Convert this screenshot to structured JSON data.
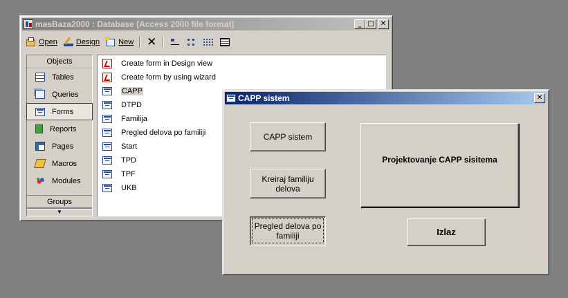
{
  "db_window": {
    "title": "masBaza2000 : Database (Access 2000 file format)",
    "controls": {
      "minimize": "_",
      "maximize": "□",
      "close": "✕"
    },
    "toolbar": {
      "open": "Open",
      "design": "Design",
      "new": "New"
    },
    "objects_header": "Objects",
    "groups_header": "Groups",
    "scroll_down": "▼",
    "objects": [
      {
        "label": "Tables",
        "icon": "table-icon"
      },
      {
        "label": "Queries",
        "icon": "query-icon"
      },
      {
        "label": "Forms",
        "icon": "form-icon",
        "selected": true
      },
      {
        "label": "Reports",
        "icon": "report-icon"
      },
      {
        "label": "Pages",
        "icon": "page-icon"
      },
      {
        "label": "Macros",
        "icon": "macro-icon"
      },
      {
        "label": "Modules",
        "icon": "module-icon"
      }
    ],
    "list": [
      {
        "label": "Create form in Design view",
        "icon": "wizard-icon"
      },
      {
        "label": "Create form by using wizard",
        "icon": "wizard-icon"
      },
      {
        "label": "CAPP",
        "icon": "form-icon",
        "selected": true
      },
      {
        "label": "DTPD",
        "icon": "form-icon"
      },
      {
        "label": "Familija",
        "icon": "form-icon"
      },
      {
        "label": "Pregled delova po familiji",
        "icon": "form-icon"
      },
      {
        "label": "Start",
        "icon": "form-icon"
      },
      {
        "label": "TPD",
        "icon": "form-icon"
      },
      {
        "label": "TPF",
        "icon": "form-icon"
      },
      {
        "label": "UKB",
        "icon": "form-icon"
      }
    ]
  },
  "capp_window": {
    "title": "CAPP sistem",
    "close": "✕",
    "buttons": {
      "capp_sistem": "CAPP sistem",
      "kreiraj_line1": "Kreiraj familiju",
      "kreiraj_line2": "delova",
      "pregled_line1": "Pregled delova po",
      "pregled_line2": "familiji",
      "izlaz": "Izlaz"
    },
    "label": "Projektovanje CAPP sisitema"
  }
}
